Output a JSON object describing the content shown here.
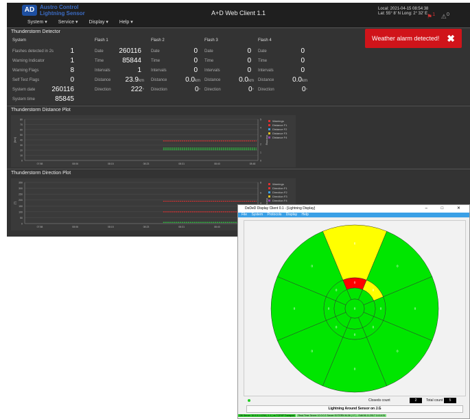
{
  "web": {
    "logo_mark": "AD",
    "logo_text_1": "Austro Control",
    "logo_text_2": "Lightning Sensor",
    "menu": [
      "System ▾",
      "Service ▾",
      "Display ▾",
      "Help ▾"
    ],
    "title": "A+D Web Client 1.1",
    "clock_line1": "Local: 2021-04-15 08:54:38",
    "clock_line2": "Lat: 55° 8' N   Long: 2° 32' E",
    "alarm_icon": "alarm-bell-icon",
    "alarm_count": "1",
    "warning_icon": "warning-triangle-icon",
    "warning_count": "0"
  },
  "detector": {
    "title": "Thunderstorm Detector",
    "system": {
      "header": "System",
      "rows": [
        {
          "label": "Flashes detected in 2s",
          "value": "1"
        },
        {
          "label": "Warning Indicator",
          "value": "1"
        },
        {
          "label": "Warning Flags",
          "value": "8"
        },
        {
          "label": "Self Test Flags",
          "value": "0"
        },
        {
          "label": "System date",
          "value": "260116"
        },
        {
          "label": "System time",
          "value": "85845"
        }
      ]
    },
    "flashes": [
      {
        "header": "Flash 1",
        "date": "260116",
        "time": "85844",
        "intervals": "1",
        "distance": "23.9",
        "direction": "222"
      },
      {
        "header": "Flash 2",
        "date": "0",
        "time": "0",
        "intervals": "0",
        "distance": "0.0",
        "direction": "0"
      },
      {
        "header": "Flash 3",
        "date": "0",
        "time": "0",
        "intervals": "0",
        "distance": "0.0",
        "direction": "0"
      },
      {
        "header": "Flash 4",
        "date": "0",
        "time": "0",
        "intervals": "0",
        "distance": "0.0",
        "direction": "0"
      }
    ],
    "labels": {
      "date": "Date",
      "time": "Time",
      "intervals": "Intervals",
      "distance": "Distance",
      "direction": "Direction",
      "km": "km",
      "deg": "°"
    }
  },
  "alarm": {
    "text": "Weather alarm detected!",
    "close": "✖"
  },
  "distance_plot": {
    "title": "Thunderstorm Distance Plot",
    "ylabel": "[km]",
    "y2label": "Warning",
    "legend": [
      "Warnings",
      "Distance F1",
      "Distance F2",
      "Distance F3",
      "Distance F4"
    ],
    "legend_colors": [
      "#e03030",
      "#e03030",
      "#3aa0e6",
      "#e0c020",
      "#8e44ad"
    ]
  },
  "direction_plot": {
    "title": "Thunderstorm Direction Plot",
    "ylabel": "[°]",
    "y2label": "Warning",
    "legend": [
      "Warnings",
      "Direction F1",
      "Direction F2",
      "Direction F3",
      "Direction F4"
    ],
    "legend_colors": [
      "#e03030",
      "#e03030",
      "#3aa0e6",
      "#e0c020",
      "#8e44ad"
    ]
  },
  "chart_data": [
    {
      "type": "line",
      "title": "Thunderstorm Distance Plot",
      "ylabel": "[km]",
      "y2label": "Warning",
      "x": [
        "07:58",
        "08:06",
        "08:15",
        "08:23",
        "08:31",
        "08:40",
        "08:48"
      ],
      "ylim": [
        0,
        80
      ],
      "yticks": [
        0,
        10,
        20,
        30,
        40,
        50,
        60,
        70,
        80
      ],
      "y2lim": [
        0,
        5
      ],
      "y2ticks": [
        0,
        1,
        2,
        3,
        4,
        5
      ],
      "series": [
        {
          "name": "Warnings",
          "color": "#e03030",
          "y_start_x": "08:27",
          "value": 38
        },
        {
          "name": "Distance F1",
          "color": "#2ecc40",
          "y_start_x": "08:27",
          "value": 24
        },
        {
          "name": "Distance F2",
          "color": "#2ecc40",
          "y_start_x": "08:27",
          "value": 21
        }
      ]
    },
    {
      "type": "line",
      "title": "Thunderstorm Direction Plot",
      "ylabel": "[°]",
      "y2label": "Warning",
      "x": [
        "07:58",
        "08:06",
        "08:15",
        "08:23",
        "08:31",
        "08:40",
        "08:48"
      ],
      "ylim": [
        0,
        350
      ],
      "yticks": [
        0,
        50,
        100,
        150,
        200,
        250,
        300,
        350
      ],
      "y2lim": [
        0,
        8
      ],
      "y2ticks": [
        0,
        2,
        4,
        6,
        8
      ],
      "series": [
        {
          "name": "Warnings",
          "color": "#e03030",
          "y_start_x": "08:27",
          "value": 190
        },
        {
          "name": "Direction F1",
          "color": "#e03030",
          "y_start_x": "08:27",
          "value": 100
        },
        {
          "name": "Direction F2",
          "color": "#2ecc40",
          "y_start_x": "08:27",
          "value": 10
        }
      ]
    }
  ],
  "window": {
    "title": "DeDeD Display Client 0.1 - [Lightning Display]",
    "controls": "– □ ✕",
    "menu": [
      "File",
      "System",
      "Protocols",
      "Display",
      "Help"
    ],
    "closeds_label": "Closeds count",
    "closeds_value": "2",
    "total_label": "Total count",
    "total_value": "5",
    "sensor_button": "Lightning Around Sensor on J.G",
    "status_1": "DB Server 10.0.0.1:1234 | 1.1 | vs TCP/IP Transport",
    "status_2": "Real-Time Server 10.0.0.2 Server EXTERN M-06 | 17 | - Edit   06.11.2017 14:14:31",
    "sector_colors": {
      "ok": "#00e600",
      "warn": "#ffff00",
      "alarm": "#ff0000"
    },
    "sectors": {
      "outer": [
        "0",
        "0",
        "0",
        "0",
        "0",
        "0",
        "0",
        "0"
      ],
      "outer_warn": "8",
      "middle": [
        "0",
        "0",
        "0",
        "0",
        "0",
        "0",
        "0",
        "0"
      ],
      "inner_alarm": "0",
      "inner_warn": "0",
      "center": "0"
    }
  }
}
